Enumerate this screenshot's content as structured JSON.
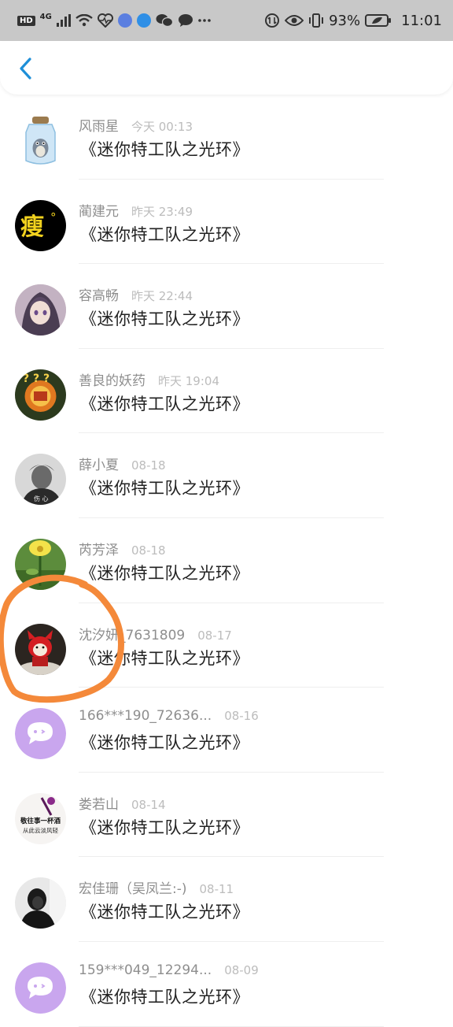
{
  "status_bar": {
    "hd_badge": "HD",
    "network": "4G",
    "battery_percent": "93%",
    "time": "11:01"
  },
  "header": {
    "back_icon": "chevron-left-icon"
  },
  "messages": [
    {
      "name": "风雨星",
      "date": "今天 00:13",
      "text": "《迷你特工队之光环》",
      "avatar": "totoro-jar"
    },
    {
      "name": "蔺建元",
      "date": "昨天 23:49",
      "text": "《迷你特工队之光环》",
      "avatar": "text-shou"
    },
    {
      "name": "容高畅",
      "date": "昨天 22:44",
      "text": "《迷你特工队之光环》",
      "avatar": "anime-girl"
    },
    {
      "name": "善良的妖药",
      "date": "昨天 19:04",
      "text": "《迷你特工队之光环》",
      "avatar": "badge-orange"
    },
    {
      "name": "薛小夏",
      "date": "08-18",
      "text": "《迷你特工队之光环》",
      "avatar": "mono-person"
    },
    {
      "name": "芮芳泽",
      "date": "08-18",
      "text": "《迷你特工队之光环》",
      "avatar": "yellow-flower"
    },
    {
      "name": "沈汐妍_7631809",
      "date": "08-17",
      "text": "《迷你特工队之光环》",
      "avatar": "red-bird"
    },
    {
      "name": "166***190_72636...",
      "date": "08-16",
      "text": "《迷你特工队之光环》",
      "avatar": "default-chat"
    },
    {
      "name": "娄若山",
      "date": "08-14",
      "text": "《迷你特工队之光环》",
      "avatar": "calligraphy",
      "avatar_text_1": "敬往事一杯酒",
      "avatar_text_2": "从此云淡风轻"
    },
    {
      "name": "宏佳珊（吴凤兰:-)",
      "date": "08-11",
      "text": "《迷你特工队之光环》",
      "avatar": "dark-person"
    },
    {
      "name": "159***049_12294...",
      "date": "08-09",
      "text": "《迷你特工队之光环》",
      "avatar": "default-chat"
    }
  ],
  "colors": {
    "status_bar_bg": "#c8c8c8",
    "accent_blue": "#1e8fd8",
    "name_gray": "#8e8e8e",
    "date_gray": "#bcbcbc",
    "annotation_orange": "#f4893a",
    "default_avatar_purple": "#c9a6ee"
  }
}
